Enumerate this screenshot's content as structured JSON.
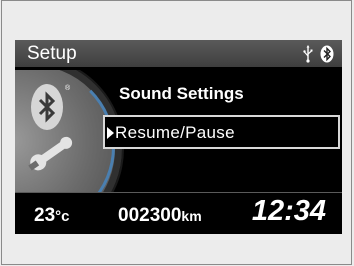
{
  "header": {
    "title": "Setup",
    "status_icons": [
      "usb-icon",
      "bluetooth-icon"
    ]
  },
  "menu": {
    "heading": "Sound Settings",
    "selected_item": "Resume/Pause"
  },
  "side_graphic": {
    "icons": [
      "bluetooth-icon",
      "wrench-icon"
    ],
    "registered_mark": "®"
  },
  "footer": {
    "temperature": "23",
    "temperature_unit": "°c",
    "odometer": "002300",
    "odometer_unit": "km",
    "clock": "12:34"
  },
  "colors": {
    "screen_bg": "#000000",
    "titlebar_bg": "#4a4a4a",
    "accent_blue": "#4a7fb0",
    "text": "#ffffff",
    "highlight_border": "#d8d8d8"
  }
}
